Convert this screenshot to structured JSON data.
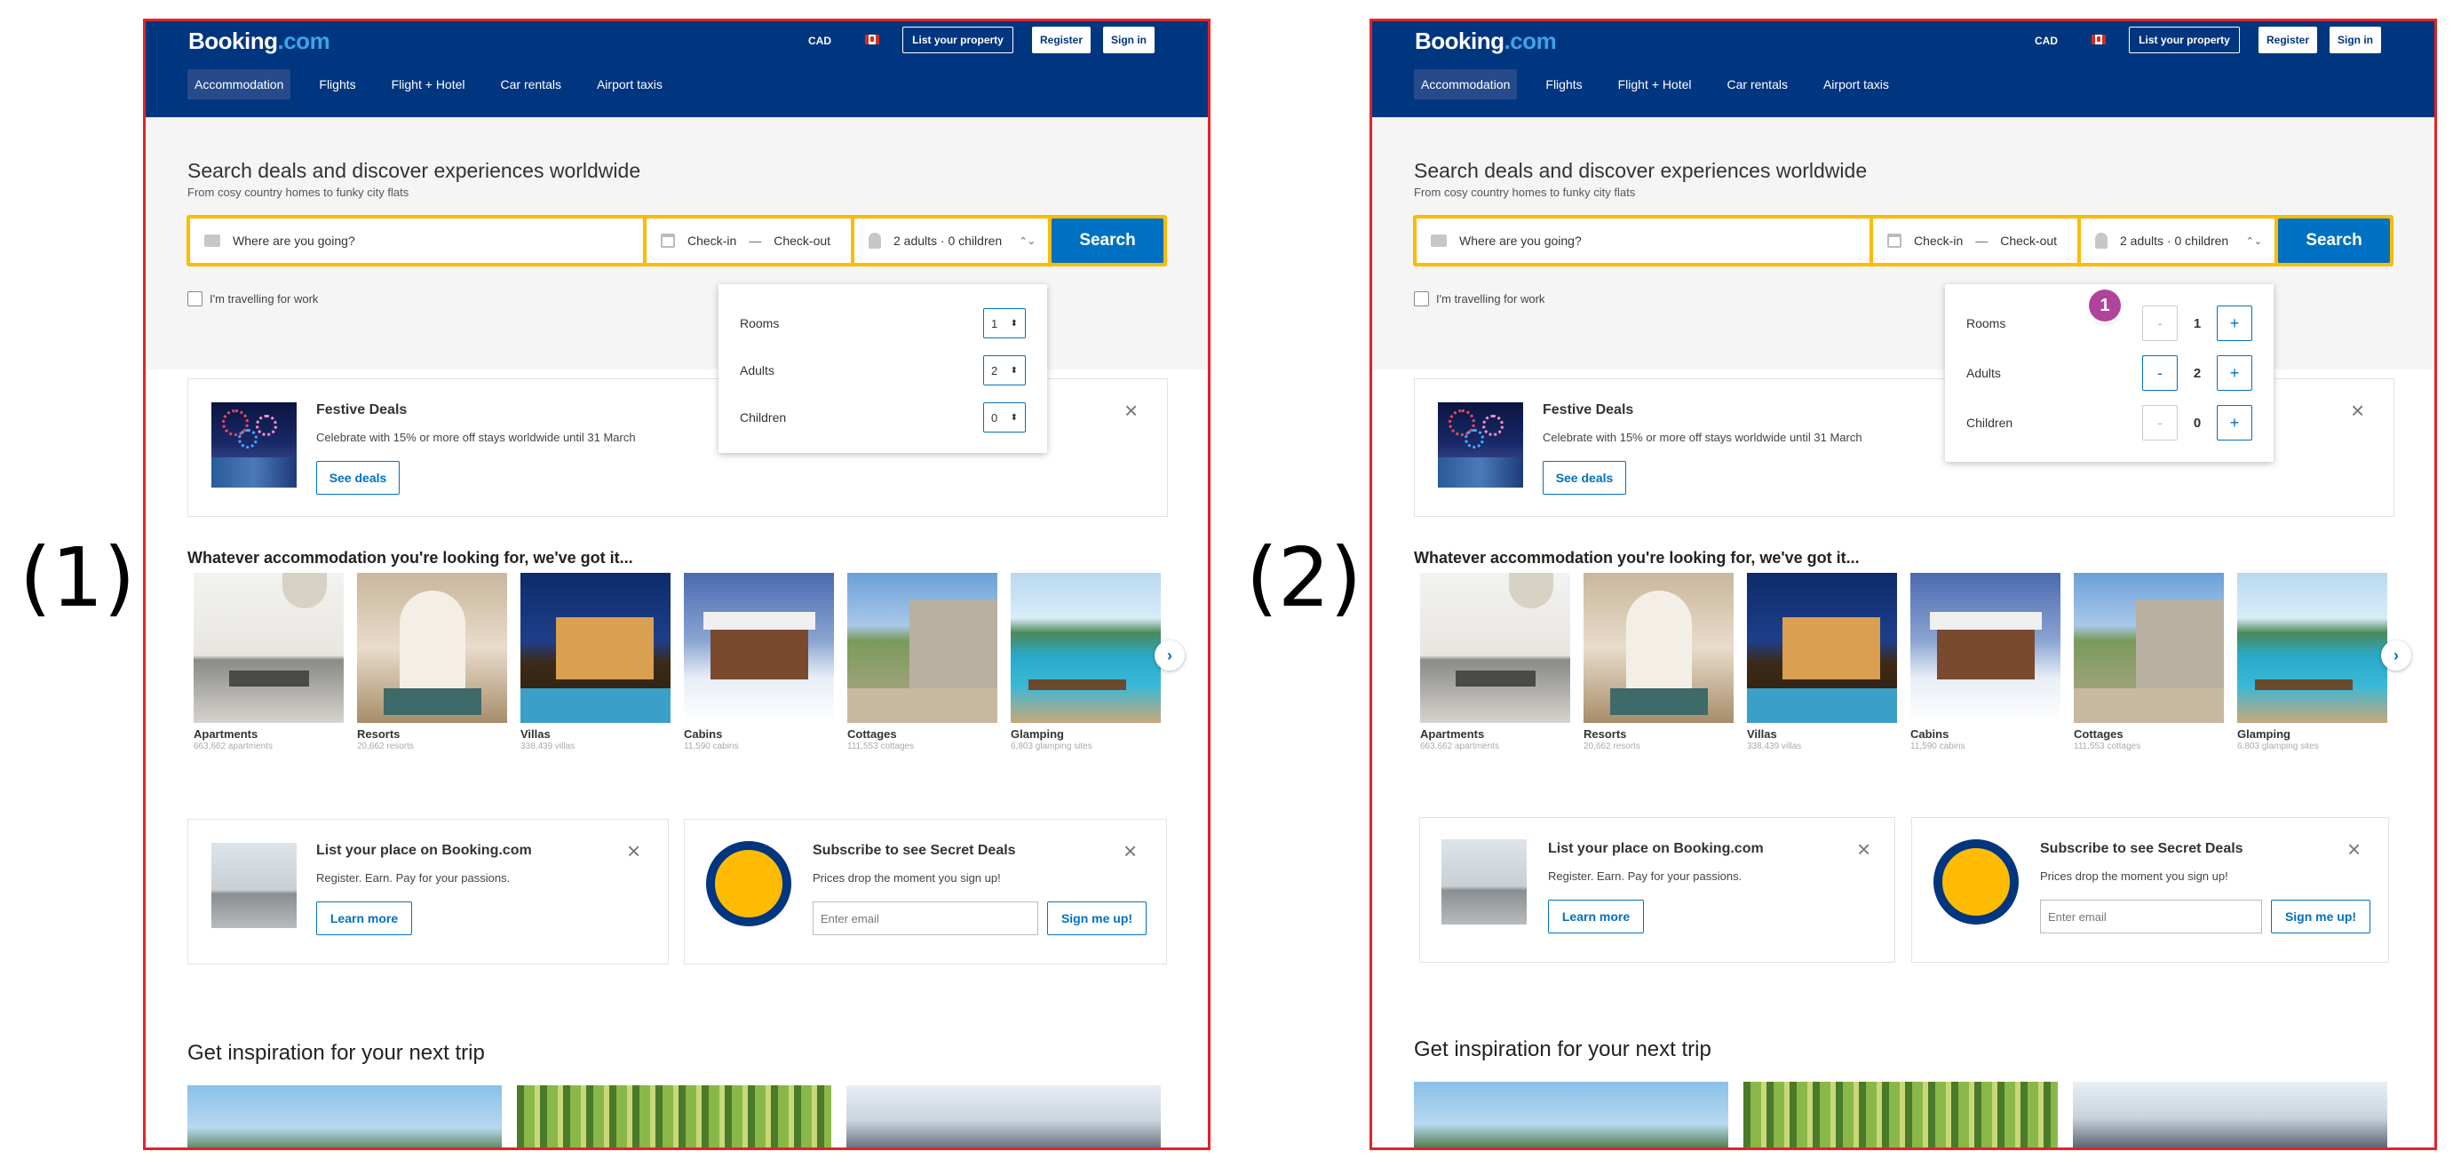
{
  "labels": {
    "panel1": "(1)",
    "panel2": "(2)"
  },
  "header": {
    "logo_main": "Booking",
    "logo_suffix": ".com",
    "currency": "CAD",
    "list_property": "List your property",
    "register": "Register",
    "sign_in": "Sign in"
  },
  "nav": {
    "items": [
      "Accommodation",
      "Flights",
      "Flight + Hotel",
      "Car rentals",
      "Airport taxis"
    ]
  },
  "hero": {
    "title": "Search deals and discover experiences worldwide",
    "subtitle": "From cosy country homes to funky city flats"
  },
  "search": {
    "destination_placeholder": "Where are you going?",
    "checkin": "Check-in",
    "dash": "—",
    "checkout": "Check-out",
    "guests": "2 adults · 0 children",
    "guests_chevron": "⌃⌄",
    "button": "Search",
    "work_label": "I'm travelling for work"
  },
  "guest_dropdown": {
    "rows": [
      {
        "label": "Rooms",
        "value": "1"
      },
      {
        "label": "Adults",
        "value": "2"
      },
      {
        "label": "Children",
        "value": "0"
      }
    ],
    "minus": "-",
    "plus": "+",
    "select_arrow": "⬍",
    "badge": "1"
  },
  "festive": {
    "title": "Festive Deals",
    "text": "Celebrate with 15% or more off stays worldwide until 31 March",
    "button": "See deals",
    "close": "×"
  },
  "accommodation": {
    "title": "Whatever accommodation you're looking for, we've got it...",
    "types": [
      {
        "name": "Apartments",
        "count": "663,662 apartments"
      },
      {
        "name": "Resorts",
        "count": "20,662 resorts"
      },
      {
        "name": "Villas",
        "count": "338,439 villas"
      },
      {
        "name": "Cabins",
        "count": "11,590 cabins"
      },
      {
        "name": "Cottages",
        "count": "111,553 cottages"
      },
      {
        "name": "Glamping",
        "count": "6,803 glamping sites"
      }
    ],
    "next": "›"
  },
  "list_place": {
    "title": "List your place on Booking.com",
    "text": "Register. Earn. Pay for your passions.",
    "button": "Learn more",
    "close": "×"
  },
  "secret_deals": {
    "title": "Subscribe to see Secret Deals",
    "text": "Prices drop the moment you sign up!",
    "email_placeholder": "Enter email",
    "button": "Sign me up!",
    "close": "×"
  },
  "inspiration": {
    "title": "Get inspiration for your next trip"
  },
  "colors": {
    "brand": "#003580",
    "accent": "#0071c2",
    "search_border": "#febb02",
    "frame": "#e52228",
    "badge": "#b0449c"
  }
}
